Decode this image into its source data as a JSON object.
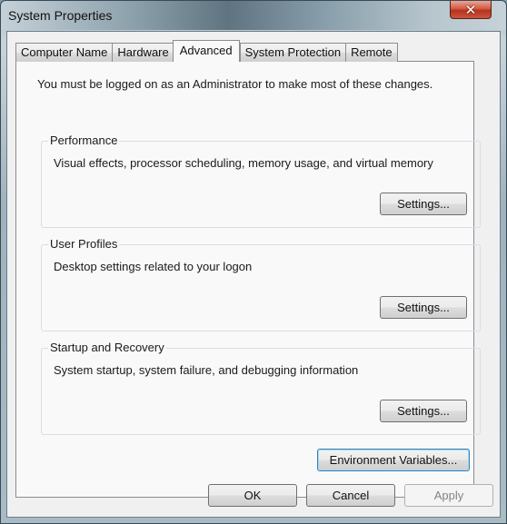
{
  "window": {
    "title": "System Properties",
    "close_icon": "close-x-icon"
  },
  "tabs": [
    {
      "label": "Computer Name",
      "active": false
    },
    {
      "label": "Hardware",
      "active": false
    },
    {
      "label": "Advanced",
      "active": true
    },
    {
      "label": "System Protection",
      "active": false
    },
    {
      "label": "Remote",
      "active": false
    }
  ],
  "advanced": {
    "admin_note": "You must be logged on as an Administrator to make most of these changes.",
    "groups": [
      {
        "label": "Performance",
        "description": "Visual effects, processor scheduling, memory usage, and virtual memory",
        "button": "Settings..."
      },
      {
        "label": "User Profiles",
        "description": "Desktop settings related to your logon",
        "button": "Settings..."
      },
      {
        "label": "Startup and Recovery",
        "description": "System startup, system failure, and debugging information",
        "button": "Settings..."
      }
    ],
    "env_button": "Environment Variables..."
  },
  "footer": {
    "ok": "OK",
    "cancel": "Cancel",
    "apply": "Apply"
  }
}
